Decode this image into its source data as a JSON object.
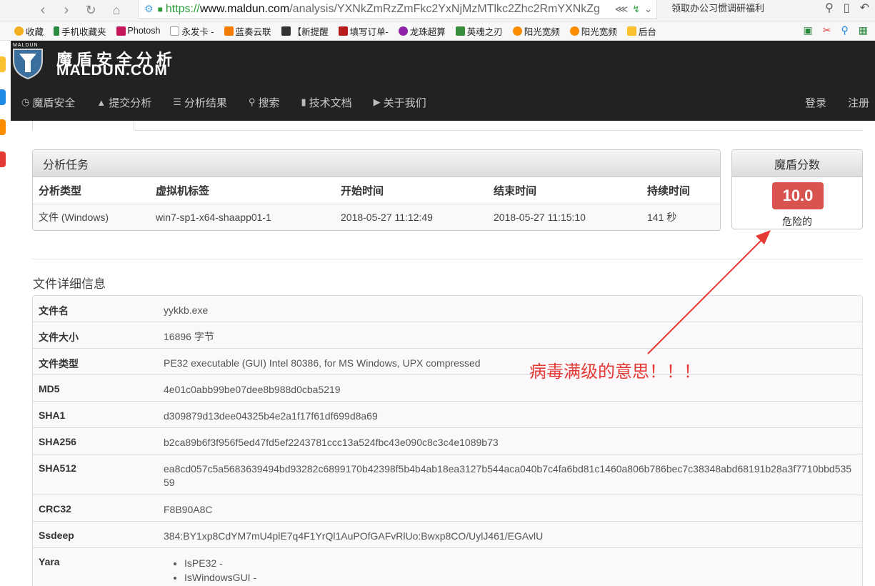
{
  "browser": {
    "url_scheme": "https://",
    "url_host": "www.maldun.com",
    "url_path": "/analysis/YXNkZmRzZmFkc2YxNjMzMTlkc2Zhc2RmYXNkZg",
    "promo_text": "领取办公习惯调研福利",
    "bookmarks": [
      {
        "label": "收藏",
        "color": "#f2b01e"
      },
      {
        "label": "手机收藏夹",
        "color": "#2b8a3e"
      },
      {
        "label": "Photosh",
        "color": "#c2185b"
      },
      {
        "label": "永发卡 -",
        "color": "#9e9e9e"
      },
      {
        "label": "蓝奏云联",
        "color": "#f57c00"
      },
      {
        "label": "【新提醒",
        "color": "#333333"
      },
      {
        "label": "填写订单-",
        "color": "#b71c1c"
      },
      {
        "label": "龙珠超算",
        "color": "#8e24aa"
      },
      {
        "label": "英魂之刃",
        "color": "#388e3c"
      },
      {
        "label": "阳光宽频",
        "color": "#fb8c00"
      },
      {
        "label": "阳光宽频",
        "color": "#fb8c00"
      },
      {
        "label": "后台",
        "color": "#fbc02d"
      }
    ]
  },
  "site": {
    "logo_small": "MALDUN",
    "logo_cn": "魔盾安全分析",
    "logo_en": "MALDUN.COM",
    "nav": [
      {
        "label": "魔盾安全",
        "icon": "clock-icon"
      },
      {
        "label": "提交分析",
        "icon": "upload-icon"
      },
      {
        "label": "分析结果",
        "icon": "list-icon"
      },
      {
        "label": "搜索",
        "icon": "search-icon"
      },
      {
        "label": "技术文档",
        "icon": "file-icon"
      },
      {
        "label": "关于我们",
        "icon": "bullhorn-icon"
      }
    ],
    "login": "登录",
    "register": "注册"
  },
  "task": {
    "title": "分析任务",
    "headers": [
      "分析类型",
      "虚拟机标签",
      "开始时间",
      "结束时间",
      "持续时间"
    ],
    "row": [
      "文件 (Windows)",
      "win7-sp1-x64-shaapp01-1",
      "2018-05-27 11:12:49",
      "2018-05-27 11:15:10",
      "141 秒"
    ]
  },
  "score": {
    "title": "魔盾分数",
    "value": "10.0",
    "label": "危险的",
    "color": "#d9534f"
  },
  "details": {
    "title": "文件详细信息",
    "rows": [
      {
        "key": "文件名",
        "value": "yykkb.exe"
      },
      {
        "key": "文件大小",
        "value": "16896 字节"
      },
      {
        "key": "文件类型",
        "value": "PE32 executable (GUI) Intel 80386, for MS Windows, UPX compressed"
      },
      {
        "key": "MD5",
        "value": "4e01c0abb99be07dee8b988d0cba5219"
      },
      {
        "key": "SHA1",
        "value": "d309879d13dee04325b4e2a1f17f61df699d8a69"
      },
      {
        "key": "SHA256",
        "value": "b2ca89b6f3f956f5ed47fd5ef2243781ccc13a524fbc43e090c8c3c4e1089b73"
      },
      {
        "key": "SHA512",
        "value": "ea8cd057c5a5683639494bd93282c6899170b42398f5b4b4ab18ea3127b544aca040b7c4fa6bd81c1460a806b786bec7c38348abd68191b28a3f7710bbd53559"
      },
      {
        "key": "CRC32",
        "value": "F8B90A8C"
      },
      {
        "key": "Ssdeep",
        "value": "384:BY1xp8CdYM7mU4plE7q4F1YrQl1AuPOfGAFvRlUo:Bwxp8CO/UylJ461/EGAvlU"
      }
    ],
    "yara_key": "Yara",
    "yara_items": [
      "IsPE32 -",
      "IsWindowsGUI -"
    ]
  },
  "annotation": {
    "text": "病毒满级的意思！！！",
    "color": "#e53935"
  }
}
